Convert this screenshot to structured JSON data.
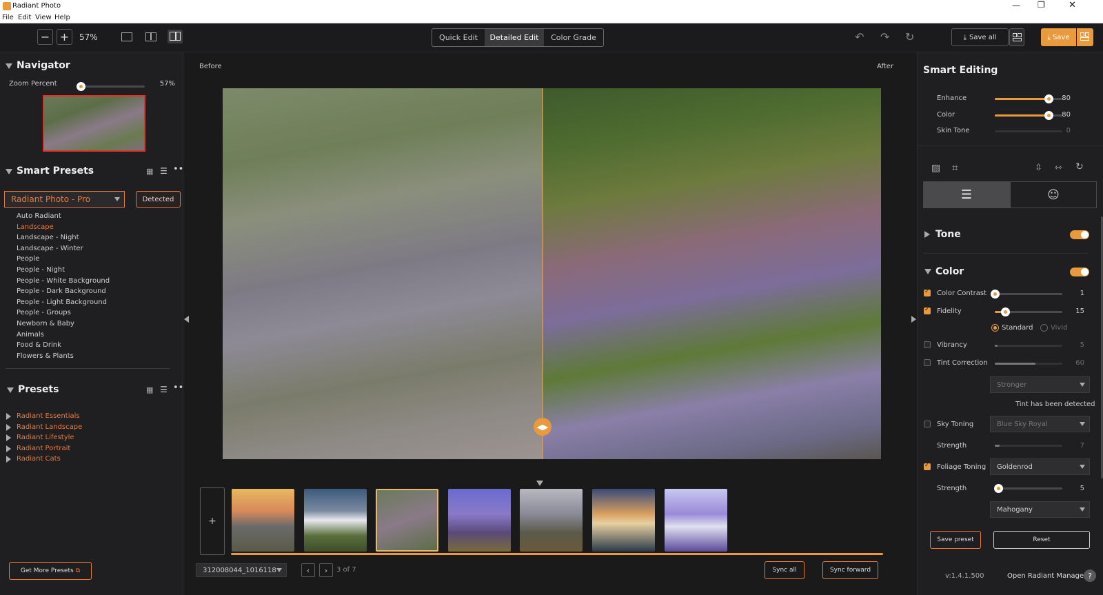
{
  "window": {
    "title": "Radiant Photo",
    "controls": [
      "minimize-icon",
      "restore-icon",
      "close-icon"
    ]
  },
  "menu": [
    "File",
    "Edit",
    "View",
    "Help"
  ],
  "toolbar": {
    "zoom_minus": "−",
    "zoom_plus": "+",
    "zoom_value": "57%",
    "modes": [
      "Quick Edit",
      "Detailed Edit",
      "Color Grade"
    ],
    "active_mode": "Detailed Edit",
    "save_all_label": "Save all",
    "save_label": "Save",
    "accent": "#e89a3c"
  },
  "navigator": {
    "title": "Navigator",
    "zoom_label": "Zoom Percent",
    "zoom_value": "57%",
    "zoom_fraction": 0.0
  },
  "smart_presets": {
    "title": "Smart Presets",
    "selected_pack": "Radiant Photo - Pro",
    "detected_label": "Detected",
    "items": [
      "Auto Radiant",
      "Landscape",
      "Landscape - Night",
      "Landscape - Winter",
      "People",
      "People - Night",
      "People - White Background",
      "People - Dark Background",
      "People - Light Background",
      "People - Groups",
      "Newborn & Baby",
      "Animals",
      "Food & Drink",
      "Flowers & Plants"
    ],
    "active_item": "Landscape"
  },
  "presets": {
    "title": "Presets",
    "folders": [
      "Radiant Essentials",
      "Radiant Landscape",
      "Radiant Lifestyle",
      "Radiant Portrait",
      "Radiant Cats"
    ]
  },
  "get_more": "Get More Presets",
  "canvas": {
    "before_label": "Before",
    "after_label": "After"
  },
  "filmstrip": {
    "add_label": "+",
    "thumb_count": 7,
    "selected_index": 2,
    "filename": "312008044_1016118",
    "position": "3 of 7",
    "sync_all": "Sync all",
    "sync_forward": "Sync forward"
  },
  "smart_editing": {
    "title": "Smart Editing",
    "sliders": [
      {
        "label": "Enhance",
        "value": "80",
        "fraction": 0.8
      },
      {
        "label": "Color",
        "value": "80",
        "fraction": 0.8
      },
      {
        "label": "Skin Tone",
        "value": "0",
        "fraction": 0.0,
        "disabled": true
      }
    ]
  },
  "tone": {
    "title": "Tone",
    "on": true
  },
  "color": {
    "title": "Color",
    "on": true,
    "color_contrast": {
      "label": "Color Contrast",
      "value": "1",
      "fraction": 0.0,
      "checked": true
    },
    "fidelity": {
      "label": "Fidelity",
      "value": "15",
      "fraction": 0.15,
      "checked": true
    },
    "mode_standard": "Standard",
    "mode_vivid": "Vivid",
    "vibrancy": {
      "label": "Vibrancy",
      "value": "5",
      "fraction": 0.0,
      "checked": false
    },
    "tint_correction": {
      "label": "Tint Correction",
      "value": "60",
      "fraction": 0.6,
      "checked": false
    },
    "tint_strength": "Stronger",
    "tint_note": "Tint has been detected",
    "sky_toning": {
      "label": "Sky Toning",
      "option": "Blue Sky Royal",
      "checked": false
    },
    "sky_strength": {
      "label": "Strength",
      "value": "7",
      "fraction": 0.0
    },
    "foliage_toning": {
      "label": "Foliage Toning",
      "option": "Goldenrod",
      "checked": true
    },
    "foliage_strength": {
      "label": "Strength",
      "value": "5",
      "fraction": 0.05
    },
    "foliage_extra": "Mahogany"
  },
  "buttons": {
    "save_preset": "Save preset",
    "reset": "Reset"
  },
  "footer": {
    "version": "v:1.4.1.500",
    "manager": "Open Radiant Manager",
    "help": "?"
  }
}
